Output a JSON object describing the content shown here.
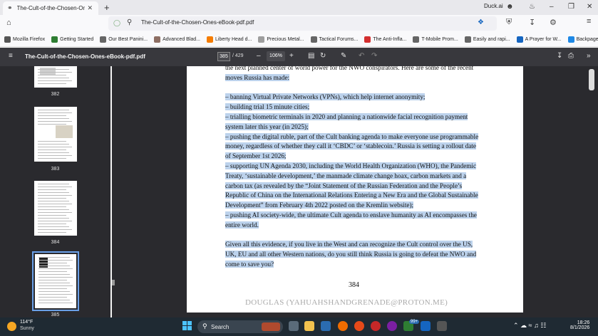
{
  "browser": {
    "tab_title": "The-Cult-of-the-Chosen-Ones",
    "url": "The-Cult-of-the-Chosen-Ones-eBook-pdf.pdf",
    "duck_label": "Duck.ai"
  },
  "bookmarks": [
    {
      "label": "Mozilla Firefox",
      "color": "#555"
    },
    {
      "label": "Getting Started",
      "color": "#2e7d32"
    },
    {
      "label": "Our Best Panini...",
      "color": "#666"
    },
    {
      "label": "Advanced Blad...",
      "color": "#8d6e63"
    },
    {
      "label": "Liberty Head d...",
      "color": "#f57c00"
    },
    {
      "label": "Precious Metal...",
      "color": "#9e9e9e"
    },
    {
      "label": "Tactical Forums...",
      "color": "#666"
    },
    {
      "label": "The Anti-Infla...",
      "color": "#d32f2f"
    },
    {
      "label": "T-Mobile Prom...",
      "color": "#666"
    },
    {
      "label": "Easily and rapi...",
      "color": "#666"
    },
    {
      "label": "A Prayer for W...",
      "color": "#1565c0"
    },
    {
      "label": "Backpage Faye...",
      "color": "#1e88e5"
    }
  ],
  "pdf": {
    "title": "The-Cult-of-the-Chosen-Ones-eBook-pdf.pdf",
    "current_page": "385",
    "total_pages": "/ 429",
    "zoom": "106%"
  },
  "sidebar": {
    "thumbnails": [
      "382",
      "383",
      "384",
      "385"
    ]
  },
  "page": {
    "lines": [
      {
        "text": "the next planned center of world power for the NWO conspirators. Here are some of the recent",
        "hl": false
      },
      {
        "text": "moves Russia has made:",
        "hl": true
      },
      {
        "text": "",
        "hl": false
      },
      {
        "text": "– banning Virtual Private Networks (VPNs), which help internet anonymity;",
        "hl": true
      },
      {
        "text": "– building trial 15 minute cities;",
        "hl": true
      },
      {
        "text": "– trialling biometric terminals in 2020 and planning a nationwide facial recognition payment",
        "hl": true
      },
      {
        "text": "system later this year (in 2025);",
        "hl": true
      },
      {
        "text": "– pushing the digital ruble, part of the Cult banking agenda to make everyone use programmable",
        "hl": true
      },
      {
        "text": "money, regardless of whether they call it ‘CBDC’ or ‘stablecoin.’ Russia is setting a rollout date",
        "hl": true
      },
      {
        "text": "of September 1st 2026;",
        "hl": true
      },
      {
        "text": "– supporting UN Agenda 2030, including the World Health Organization (WHO), the Pandemic",
        "hl": true
      },
      {
        "text": "Treaty, ‘sustainable development,’ the manmade climate change hoax, carbon markets and a",
        "hl": true
      },
      {
        "text": "carbon tax (as revealed by the “Joint Statement of the Russian Federation and the People’s",
        "hl": true
      },
      {
        "text": "Republic of China on the International Relations Entering a New Era and the Global Sustainable",
        "hl": true
      },
      {
        "text": "Development” from February 4th 2022 posted on the Kremlin website);",
        "hl": true
      },
      {
        "text": "– pushing AI society-wide, the ultimate Cult agenda to enslave humanity as AI encompasses the",
        "hl": true
      },
      {
        "text": "entire world.",
        "hl": true
      },
      {
        "text": "",
        "hl": false
      },
      {
        "text": "Given all this evidence, if you live in the West and can recognize the Cult control over the US,",
        "hl": true
      },
      {
        "text": "UK, EU and all other Western nations, do you still think Russia is going to defeat the NWO and",
        "hl": true
      },
      {
        "text": "come to save you?",
        "hl": true
      }
    ],
    "page_number": "384",
    "footer": "DOUGLAS (YAHUAHSHANDGRENADE@PROTON.ME)"
  },
  "taskbar": {
    "temperature": "114°F",
    "condition": "Sunny",
    "search_placeholder": "Search",
    "time": "18:26",
    "date": "8/1/2026"
  }
}
